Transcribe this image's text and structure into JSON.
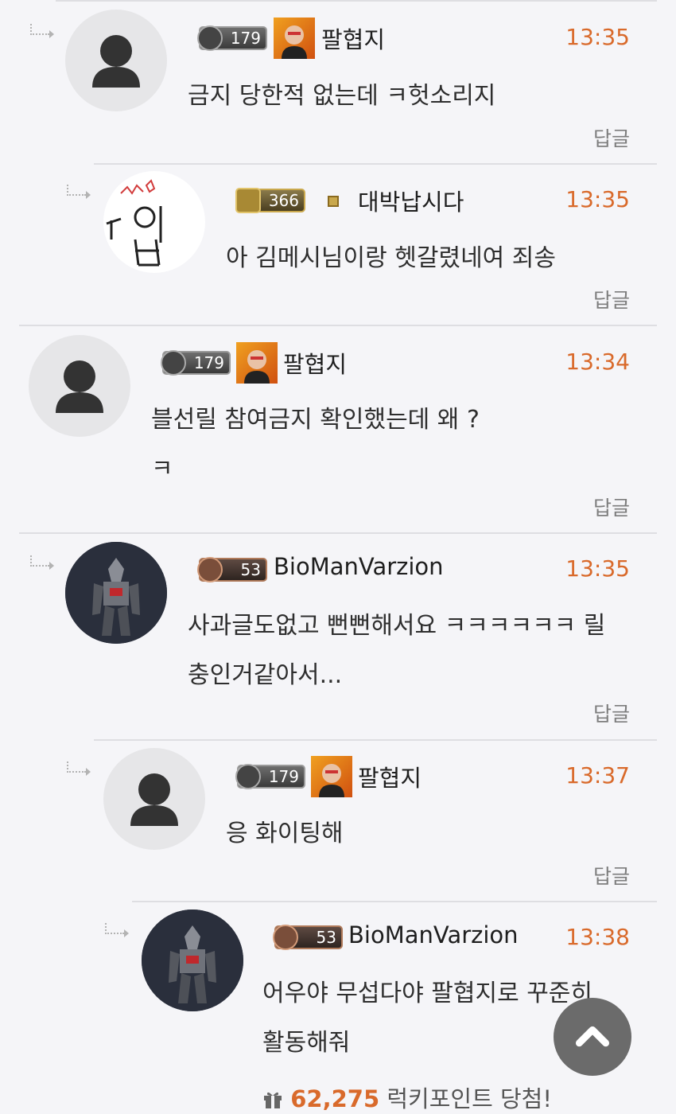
{
  "comments": [
    {
      "level": "179",
      "nick": "팔협지",
      "time": "13:35",
      "body": "금지 당한적 없는데 ㅋ헛소리지",
      "reply": "답글"
    },
    {
      "level": "366",
      "nick": "대박납시다",
      "time": "13:35",
      "body": "아 김메시님이랑 헷갈렸네여 죄송",
      "reply": "답글"
    },
    {
      "level": "179",
      "nick": "팔협지",
      "time": "13:34",
      "body": "블선릴 참여금지 확인했는데 왜 ?\nㅋ",
      "reply": "답글"
    },
    {
      "level": "53",
      "nick": "BioManVarzion",
      "time": "13:35",
      "body": "사과글도없고 뻔뻔해서요 ㅋㅋㅋㅋㅋㅋ 릴\n충인거같아서...",
      "reply": "답글"
    },
    {
      "level": "179",
      "nick": "팔협지",
      "time": "13:37",
      "body": "응 화이팅해",
      "reply": "답글"
    },
    {
      "level": "53",
      "nick": "BioManVarzion",
      "time": "13:38",
      "body": "어우야 무섭다야 팔협지로 꾸준히\n활동해줘",
      "reply": ""
    }
  ],
  "lucky": {
    "points": "62,275",
    "label": "럭키포인트 당첨!"
  },
  "colors": {
    "time": "#d96a2b",
    "background": "#f5f5f8"
  }
}
